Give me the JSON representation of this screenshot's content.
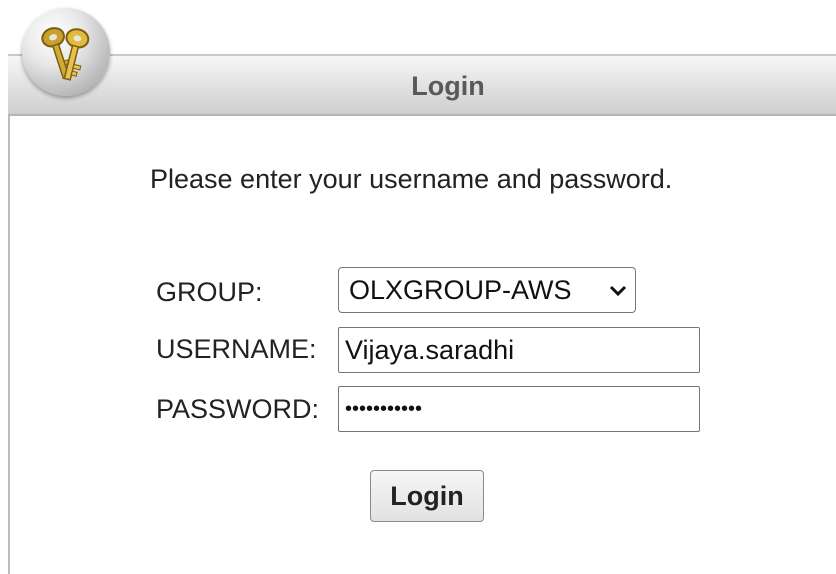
{
  "window": {
    "title": "Login"
  },
  "logo": {
    "icon": "keys-icon"
  },
  "form": {
    "prompt": "Please enter your username and password.",
    "group": {
      "label": "GROUP:",
      "selected": "OLXGROUP-AWS",
      "chevron": "⌄"
    },
    "username": {
      "label": "USERNAME:",
      "value": "Vijaya.saradhi"
    },
    "password": {
      "label": "PASSWORD:",
      "value": "•••••••••••"
    },
    "submit_label": "Login"
  },
  "colors": {
    "title_text": "#595959",
    "body_text": "#222222"
  }
}
